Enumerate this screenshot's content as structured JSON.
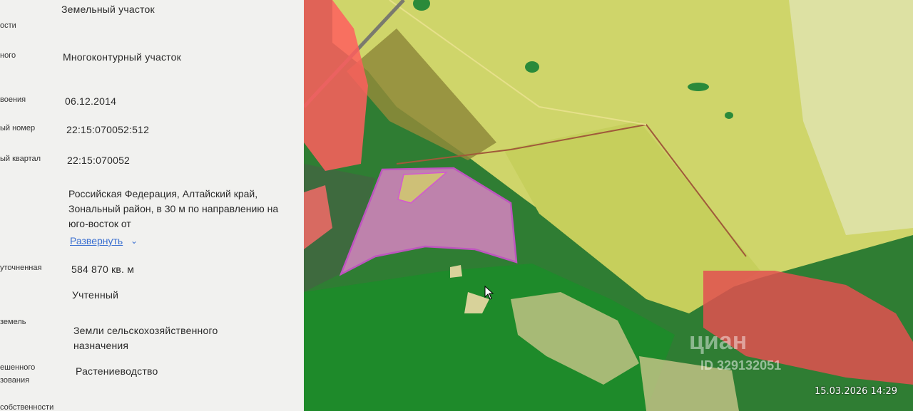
{
  "panel": {
    "rows": [
      {
        "label": "ости",
        "value": "Земельный участок"
      },
      {
        "label": "ного",
        "value": "Многоконтурный участок"
      },
      {
        "label": "воения",
        "value": "06.12.2014"
      },
      {
        "label": "ый номер",
        "value": "22:15:070052:512"
      },
      {
        "label": "ый квартал",
        "value": "22:15:070052"
      },
      {
        "label": "",
        "value": "Российская Федерация, Алтайский край, Зональный район, в 30 м по направлению на юго-восток от"
      },
      {
        "label": "уточненная",
        "value": "584 870 кв. м"
      },
      {
        "label": "",
        "value": "Учтенный"
      },
      {
        "label": "земель",
        "value": "Земли сельскохозяйственного назначения"
      },
      {
        "label": "ешенного",
        "value": "Растениеводство"
      },
      {
        "label": "зования",
        "value": ""
      },
      {
        "label": "собственности",
        "value": ""
      }
    ],
    "expand_link": "Развернуть",
    "expand_icon": "chevron-down-icon"
  },
  "map": {
    "watermark_brand": "циан",
    "watermark_id": "ID 329132051",
    "selected_parcel_color": "#d84fd8",
    "field_color": "#d7db6a",
    "forest_color": "#1f7a2c",
    "building_color": "#ff5a5a"
  },
  "camera": {
    "datetime": "15.03.2026  14:29"
  }
}
